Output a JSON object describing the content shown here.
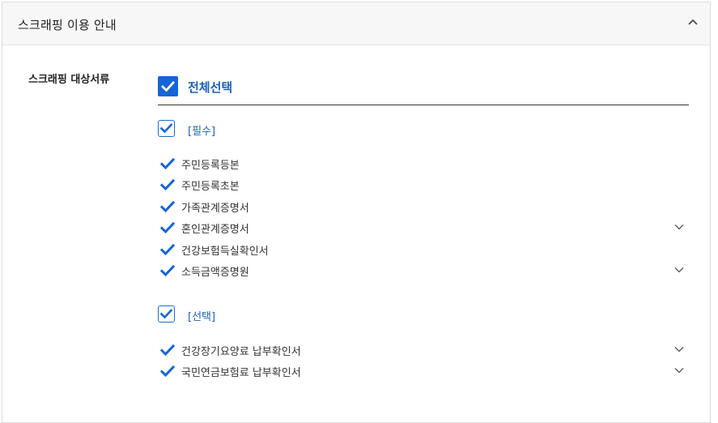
{
  "panel": {
    "title": "스크래핑 이용 안내",
    "toggle_icon": "chevron-up-icon"
  },
  "form": {
    "row_label": "스크래핑 대상서류",
    "select_all_label": "전체선택",
    "groups": [
      {
        "label": "[필수]",
        "checked": true,
        "items": [
          {
            "label": "주민등록등본",
            "checked": true,
            "expandable": false
          },
          {
            "label": "주민등록초본",
            "checked": true,
            "expandable": false
          },
          {
            "label": "가족관계증명서",
            "checked": true,
            "expandable": false
          },
          {
            "label": "혼인관계증명서",
            "checked": true,
            "expandable": true
          },
          {
            "label": "건강보험득실확인서",
            "checked": true,
            "expandable": false
          },
          {
            "label": "소득금액증명원",
            "checked": true,
            "expandable": true
          }
        ]
      },
      {
        "label": "[선택]",
        "checked": true,
        "items": [
          {
            "label": "건강장기요양료 납부확인서",
            "checked": true,
            "expandable": true
          },
          {
            "label": "국민연금보험료 납부확인서",
            "checked": true,
            "expandable": true
          }
        ]
      }
    ]
  },
  "colors": {
    "accent": "#1565d8",
    "accent_text": "#1b5fbf",
    "header_bg": "#f7f7f7"
  }
}
